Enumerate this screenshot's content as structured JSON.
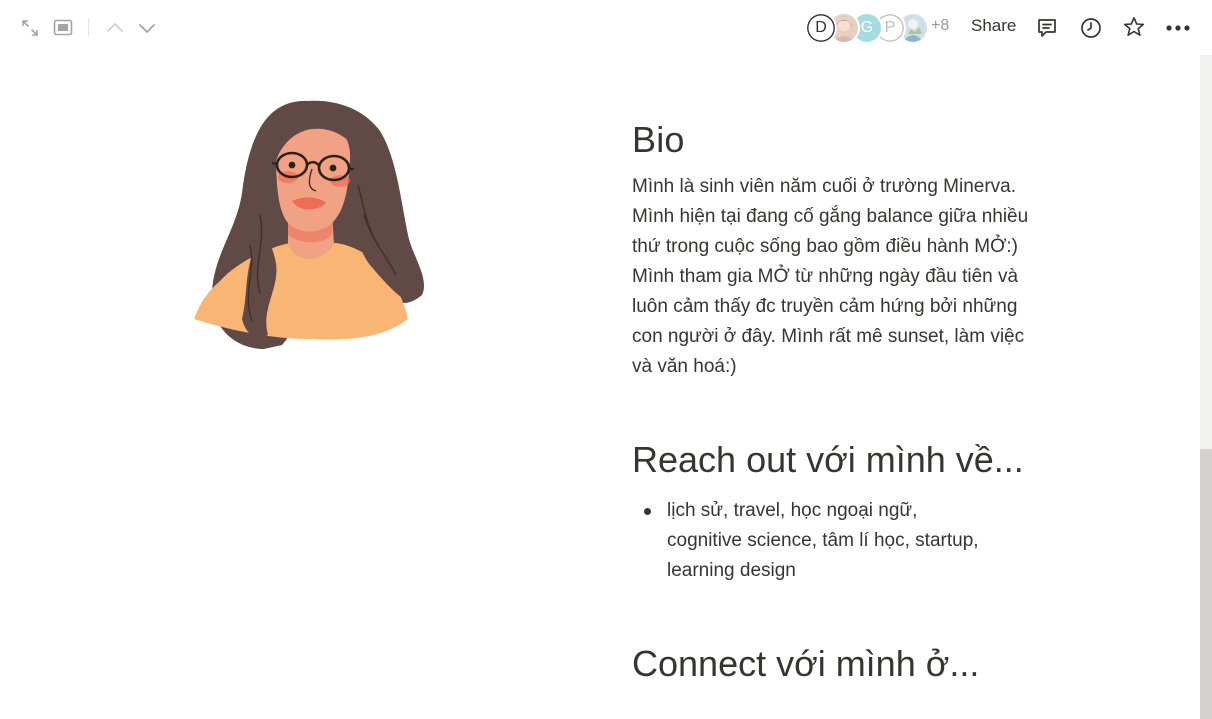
{
  "topbar": {
    "expand_icon": "expand-diagonal-icon",
    "peek_icon": "side-peek-icon",
    "up_icon": "chevron-up-icon",
    "down_icon": "chevron-down-icon",
    "avatars": [
      {
        "letter": "D",
        "type": "letter"
      },
      {
        "letter": "",
        "type": "photo",
        "color": "#e7cfc4"
      },
      {
        "letter": "G",
        "type": "pastel",
        "color": "#a6dbe0"
      },
      {
        "letter": "P",
        "type": "letter-light"
      },
      {
        "letter": "",
        "type": "photo",
        "color": "#b9d3e6"
      }
    ],
    "avatar_overflow": "+8",
    "share_label": "Share",
    "comment_icon": "comment-icon",
    "history_icon": "clock-icon",
    "favorite_icon": "star-icon",
    "more_icon": "more-horizontal-icon"
  },
  "page": {
    "bio_heading": "Bio",
    "bio_text": "Mình là sinh viên năm cuối ở trường Minerva. Mình hiện tại đang cố gắng balance giữa nhiều thứ trong cuộc sống bao gồm điều hành MỞ:) Mình tham gia MỞ từ những ngày đầu tiên và luôn cảm thấy đc truyền cảm hứng bởi những con người ở đây. Mình rất mê sunset, làm việc và văn hoá:)",
    "reach_heading": "Reach out với mình về...",
    "reach_items": [
      "lịch sử, travel, học ngoại ngữ, cognitive science, tâm lí học, startup, learning design"
    ],
    "connect_heading": "Connect với mình ở..."
  },
  "colors": {
    "text": "#37352f",
    "muted": "#9b9a97",
    "hair": "#614a45",
    "skin": "#f2a284",
    "shirt": "#f9b574",
    "blush": "#ef6c57"
  }
}
